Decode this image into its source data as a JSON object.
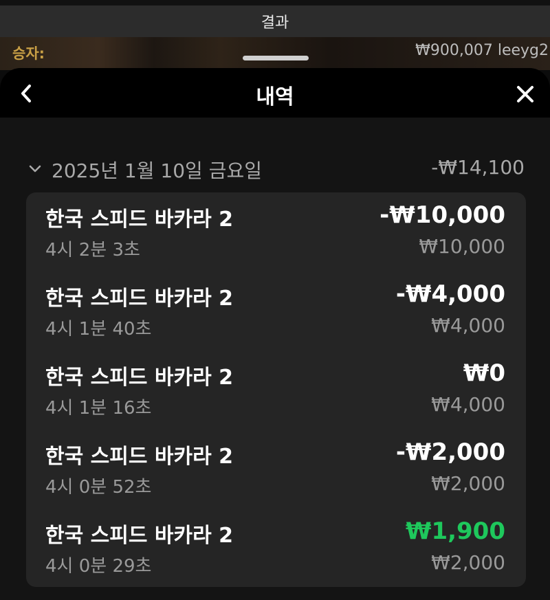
{
  "topbar": {
    "title": "결과"
  },
  "winner": {
    "label": "승자:",
    "value": "₩900,007 leeyg2"
  },
  "sheet": {
    "title": "내역"
  },
  "day": {
    "label": "2025년 1월 10일 금요일",
    "total": "-₩14,100"
  },
  "entries": [
    {
      "game": "한국 스피드 바카라 2",
      "time": "4시 2분 3초",
      "amount": "-₩10,000",
      "bet": "₩10,000",
      "is_win": false
    },
    {
      "game": "한국 스피드 바카라 2",
      "time": "4시 1분 40초",
      "amount": "-₩4,000",
      "bet": "₩4,000",
      "is_win": false
    },
    {
      "game": "한국 스피드 바카라 2",
      "time": "4시 1분 16초",
      "amount": "₩0",
      "bet": "₩4,000",
      "is_win": false
    },
    {
      "game": "한국 스피드 바카라 2",
      "time": "4시 0분 52초",
      "amount": "-₩2,000",
      "bet": "₩2,000",
      "is_win": false
    },
    {
      "game": "한국 스피드 바카라 2",
      "time": "4시 0분 29초",
      "amount": "₩1,900",
      "bet": "₩2,000",
      "is_win": true
    }
  ],
  "colors": {
    "win": "#1ec85c",
    "winner_label": "#c9a046",
    "card": "#252525"
  },
  "icons": {
    "back": "chevron-left-icon",
    "close": "close-icon",
    "collapse": "chevron-down-icon"
  }
}
